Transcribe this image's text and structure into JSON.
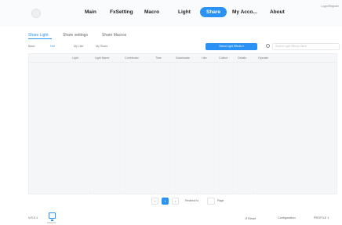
{
  "topbar": {
    "nav": [
      {
        "label": "Main",
        "active": false
      },
      {
        "label": "FxSetting",
        "active": false
      },
      {
        "label": "Macro",
        "active": false
      },
      {
        "label": "Light",
        "active": false
      },
      {
        "label": "Share",
        "active": true
      },
      {
        "label": "My Acco...",
        "active": false
      },
      {
        "label": "About",
        "active": false
      }
    ],
    "login": "Login/Register"
  },
  "subtabs": [
    {
      "label": "Share Light",
      "active": true
    },
    {
      "label": "Share settings",
      "active": false
    },
    {
      "label": "Share Macros",
      "active": false
    }
  ],
  "filter": {
    "items": [
      {
        "label": "Basic",
        "blue": false
      },
      {
        "label": "Hot",
        "blue": true
      },
      {
        "label": "My Like",
        "blue": false
      },
      {
        "label": "My Share",
        "blue": false
      }
    ],
    "dropdown": "Select Light Effects",
    "search_placeholder": "Search Light Effects Name"
  },
  "table": {
    "columns": [
      "Light",
      "Light Name",
      "Contributor",
      "Time",
      "Downloads",
      "Like",
      "Collect",
      "Details",
      "Operate"
    ]
  },
  "pager": {
    "prev": "<",
    "current": "1",
    "next": ">",
    "goto_label": "Redirect to",
    "page_label": "Page"
  },
  "footer": {
    "version": "V.R.0.1",
    "monitor_label": "DISCON",
    "reset": "Reset",
    "config": "Configuration",
    "profile": "PROFILE 1"
  },
  "colors": {
    "accent": "#2a92f4",
    "background": "#ffffff",
    "table_bg": "#f4f6f8"
  }
}
